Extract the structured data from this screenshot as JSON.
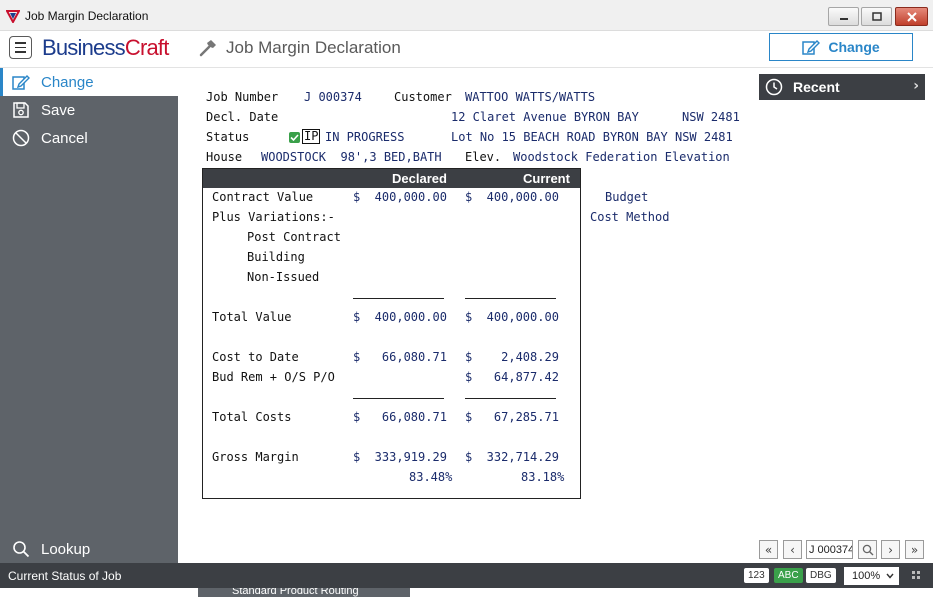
{
  "window": {
    "title": "Job Margin Declaration"
  },
  "header": {
    "logo_main": "Business",
    "logo_accent": "Craft",
    "title": "Job Margin Declaration",
    "change_label": "Change"
  },
  "sidebar": {
    "items": [
      {
        "label": "Change",
        "icon": "edit-icon",
        "active": true
      },
      {
        "label": "Save",
        "icon": "save-icon"
      },
      {
        "label": "Cancel",
        "icon": "cancel-icon"
      }
    ],
    "lookup": {
      "label": "Lookup",
      "icon": "search-icon"
    }
  },
  "form": {
    "job_number_label": "Job Number",
    "job_number": "J 000374",
    "customer_label": "Customer",
    "customer": "WATTOO WATTS/WATTS",
    "decl_date_label": "Decl. Date",
    "address1": "12 Claret Avenue BYRON BAY",
    "state1": "NSW 2481",
    "status_label": "Status",
    "status_code": "IP",
    "status_text": "IN PROGRESS",
    "address2": "Lot No 15 BEACH ROAD BYRON BAY NSW 2481",
    "house_label": "House",
    "house": "WOODSTOCK  98',3 BED,BATH",
    "elev_label": "Elev.",
    "elev": "Woodstock Federation Elevation",
    "budget_label": "Budget",
    "cost_method_label": "Cost Method"
  },
  "table": {
    "col_declared": "Declared",
    "col_current": "Current",
    "rows": {
      "contract_value": {
        "label": "Contract Value",
        "declared": "$  400,000.00",
        "current": "$  400,000.00"
      },
      "plus_variations": {
        "label": "Plus Variations:-"
      },
      "post_contract": {
        "label": "Post Contract"
      },
      "building": {
        "label": "Building"
      },
      "non_issued": {
        "label": "Non-Issued"
      },
      "total_value": {
        "label": "Total Value",
        "declared": "$  400,000.00",
        "current": "$  400,000.00"
      },
      "cost_to_date": {
        "label": "Cost to Date",
        "declared": "$   66,080.71",
        "current": "$    2,408.29"
      },
      "bud_rem": {
        "label": "Bud Rem + O/S P/O",
        "current": "$   64,877.42"
      },
      "total_costs": {
        "label": "Total Costs",
        "declared": "$   66,080.71",
        "current": "$   67,285.71"
      },
      "gross_margin": {
        "label": "Gross Margin",
        "declared": "$  333,919.29",
        "current": "$  332,714.29",
        "declared_pct": "83.48%",
        "current_pct": "83.18%"
      }
    }
  },
  "recent": {
    "label": "Recent"
  },
  "navigation": {
    "record_value": "J 000374"
  },
  "statusbar": {
    "message": "Current Status of Job",
    "pill_123": "123",
    "pill_abc": "ABC",
    "pill_dbg": "DBG",
    "zoom": "100%"
  },
  "background_window": {
    "text": "Standard Product Routing"
  },
  "colors": {
    "accent": "#2a86c8",
    "sidebar": "#5e6369",
    "dark_bar": "#3c3f44",
    "brand_blue": "#1c3c8c",
    "brand_red": "#c8102e"
  }
}
